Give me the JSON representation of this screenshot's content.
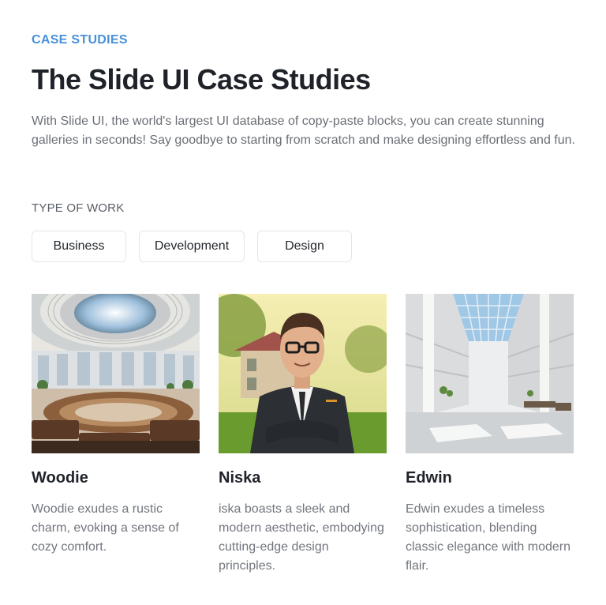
{
  "header": {
    "eyebrow": "CASE STUDIES",
    "title": "The Slide UI Case Studies",
    "description": "With Slide UI, the world's largest UI database of copy-paste blocks, you can create stunning galleries in seconds! Say goodbye to starting from scratch and make designing effortless and fun."
  },
  "filters": {
    "label": "TYPE OF WORK",
    "items": [
      "Business",
      "Development",
      "Design"
    ]
  },
  "cards": [
    {
      "title": "Woodie",
      "text": "Woodie exudes a rustic charm, evoking a sense of cozy comfort.",
      "image_alt": "rotunda-interior-image"
    },
    {
      "title": "Niska",
      "text": "iska boasts a sleek and modern aesthetic, embodying cutting-edge design principles.",
      "image_alt": "portrait-man-image"
    },
    {
      "title": "Edwin",
      "text": "Edwin exudes a timeless sophistication, blending classic elegance with modern flair.",
      "image_alt": "atrium-interior-image"
    }
  ],
  "colors": {
    "accent": "#4a90d9",
    "heading": "#1f2329",
    "body": "#6b6f76"
  }
}
